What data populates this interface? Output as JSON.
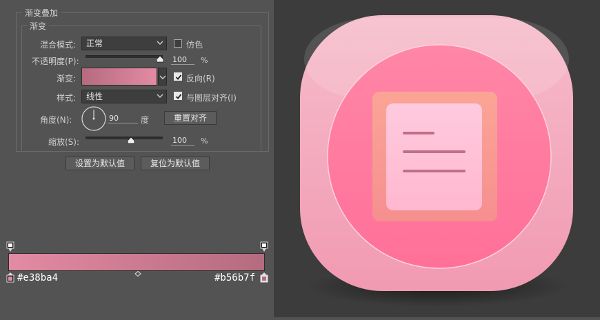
{
  "panel": {
    "section_title": "渐变叠加",
    "group_title": "渐变",
    "blend_mode": {
      "label": "混合模式:",
      "value": "正常"
    },
    "dither": {
      "label": "仿色",
      "checked": false
    },
    "opacity": {
      "label": "不透明度(P):",
      "value": "100",
      "unit": "%",
      "fraction": 1.0
    },
    "gradient": {
      "label": "渐变:",
      "from": "#e38ba4",
      "to": "#b56b7f"
    },
    "reverse": {
      "label": "反向(R)",
      "checked": true
    },
    "style": {
      "label": "样式:",
      "value": "线性"
    },
    "align": {
      "label": "与图层对齐(I)",
      "checked": true
    },
    "angle": {
      "label": "角度(N):",
      "value": "90",
      "unit": "度"
    },
    "reset_align": {
      "label": "重置对齐"
    },
    "scale": {
      "label": "缩放(S):",
      "value": "100",
      "unit": "%",
      "fraction": 0.5
    },
    "set_default": {
      "label": "设置为默认值"
    },
    "reset_default": {
      "label": "复位为默认值"
    }
  },
  "gradient_bar": {
    "left_color": "#e38ba4",
    "right_color": "#b56b7f",
    "left_hex": "#e38ba4",
    "right_hex": "#b56b7f"
  },
  "icon_colors": {
    "outer": "#f3a9bd",
    "circle": "#ff7fa0",
    "square": "#f99c95",
    "page": "#ffc3d7",
    "lines": "#c86f8b"
  }
}
